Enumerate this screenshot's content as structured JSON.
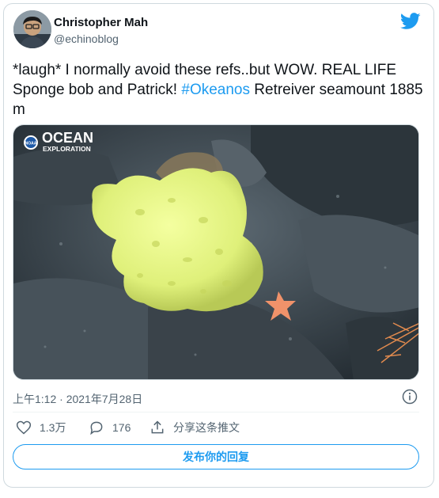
{
  "author": {
    "name": "Christopher Mah",
    "handle": "@echinoblog"
  },
  "tweet": {
    "text_before": "*laugh* I normally avoid these refs..but WOW. REAL LIFE Sponge bob and Patrick! ",
    "hashtag": "#Okeanos",
    "text_after": " Retreiver seamount 1885 m"
  },
  "media": {
    "logo_line1": "OCEAN",
    "logo_line2": "EXPLORATION",
    "logo_badge": "NOAA"
  },
  "timestamp": "上午1:12 · 2021年7月28日",
  "actions": {
    "likes": "1.3万",
    "replies": "176",
    "share_label": "分享这条推文"
  },
  "reply_button": "发布你的回复",
  "icons": {
    "brand": "twitter-bird-icon",
    "info": "info-icon",
    "like": "heart-icon",
    "reply": "comment-icon",
    "share": "share-icon"
  },
  "colors": {
    "accent": "#1d9bf0",
    "muted": "#536471",
    "border": "#cfd9de"
  }
}
